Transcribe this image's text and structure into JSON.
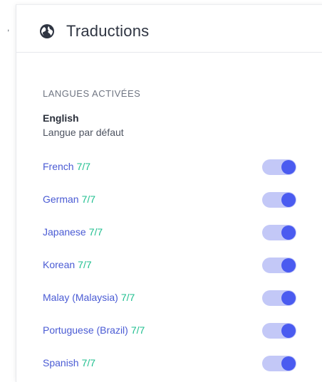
{
  "stray_mark": ",",
  "panel": {
    "title": "Traductions",
    "icon": "globe-icon"
  },
  "section": {
    "label": "LANGUES ACTIVÉES"
  },
  "default_language": {
    "name": "English",
    "subtitle": "Langue par défaut"
  },
  "languages": [
    {
      "name": "French",
      "count": "7/7",
      "enabled": true
    },
    {
      "name": "German",
      "count": "7/7",
      "enabled": true
    },
    {
      "name": "Japanese",
      "count": "7/7",
      "enabled": true
    },
    {
      "name": "Korean",
      "count": "7/7",
      "enabled": true
    },
    {
      "name": "Malay (Malaysia)",
      "count": "7/7",
      "enabled": true
    },
    {
      "name": "Portuguese (Brazil)",
      "count": "7/7",
      "enabled": true
    },
    {
      "name": "Spanish",
      "count": "7/7",
      "enabled": true
    }
  ],
  "colors": {
    "link": "#4a5bd4",
    "count": "#1fbf8f",
    "toggle_track": "#c3c8f7",
    "toggle_knob": "#4a5bf0"
  }
}
